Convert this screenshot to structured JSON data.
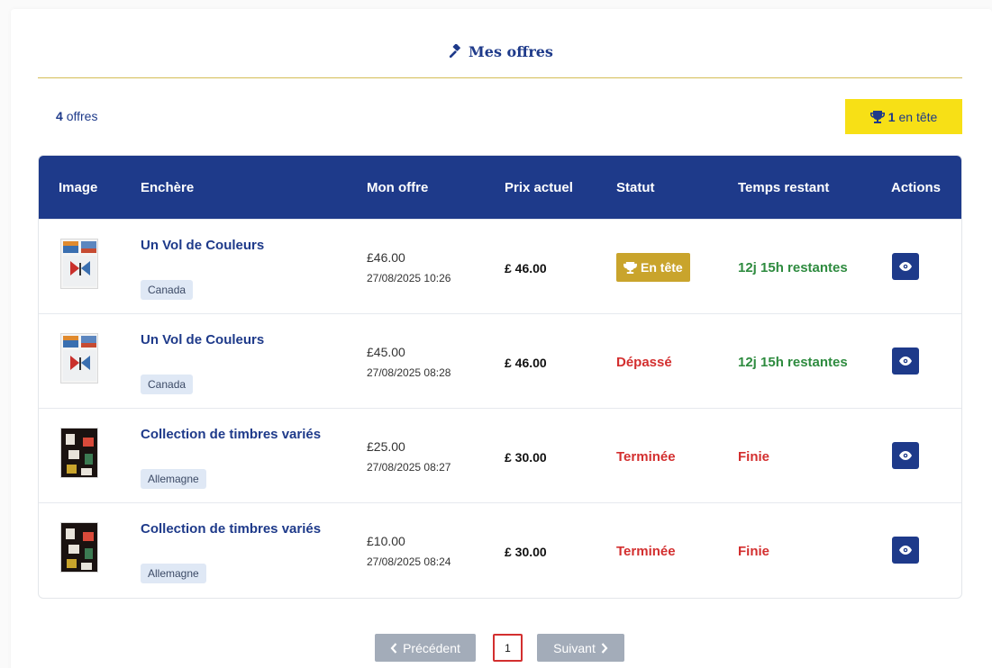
{
  "page": {
    "title": "Mes offres",
    "count_value": "4",
    "count_label": "offres",
    "leading_value": "1",
    "leading_label": "en tête"
  },
  "table": {
    "headers": [
      "Image",
      "Enchère",
      "Mon offre",
      "Prix actuel",
      "Statut",
      "Temps restant",
      "Actions"
    ],
    "rows": [
      {
        "image_icon": "stamp-butterfly-image",
        "title": "Un Vol de Couleurs",
        "country": "Canada",
        "offer": "£46.00",
        "date": "27/08/2025 10:26",
        "price": "£ 46.00",
        "status": "En tête",
        "status_kind": "leading",
        "time": "12j 15h restantes",
        "time_kind": "active"
      },
      {
        "image_icon": "stamp-butterfly-image",
        "title": "Un Vol de Couleurs",
        "country": "Canada",
        "offer": "£45.00",
        "date": "27/08/2025 08:28",
        "price": "£ 46.00",
        "status": "Dépassé",
        "status_kind": "outbid",
        "time": "12j 15h restantes",
        "time_kind": "active"
      },
      {
        "image_icon": "stamp-collection-image",
        "title": "Collection de timbres variés",
        "country": "Allemagne",
        "offer": "£25.00",
        "date": "27/08/2025 08:27",
        "price": "£ 30.00",
        "status": "Terminée",
        "status_kind": "ended",
        "time": "Finie",
        "time_kind": "ended"
      },
      {
        "image_icon": "stamp-collection-image",
        "title": "Collection de timbres variés",
        "country": "Allemagne",
        "offer": "£10.00",
        "date": "27/08/2025 08:24",
        "price": "£ 30.00",
        "status": "Terminée",
        "status_kind": "ended",
        "time": "Finie",
        "time_kind": "ended"
      }
    ]
  },
  "pagination": {
    "prev_label": "Précédent",
    "current_page": "1",
    "next_label": "Suivant"
  },
  "colors": {
    "primary": "#1e3a8a",
    "leading_badge": "#f7e016",
    "status_leading": "#c9a42c",
    "danger": "#d32f2f",
    "success": "#2e8b3f"
  }
}
